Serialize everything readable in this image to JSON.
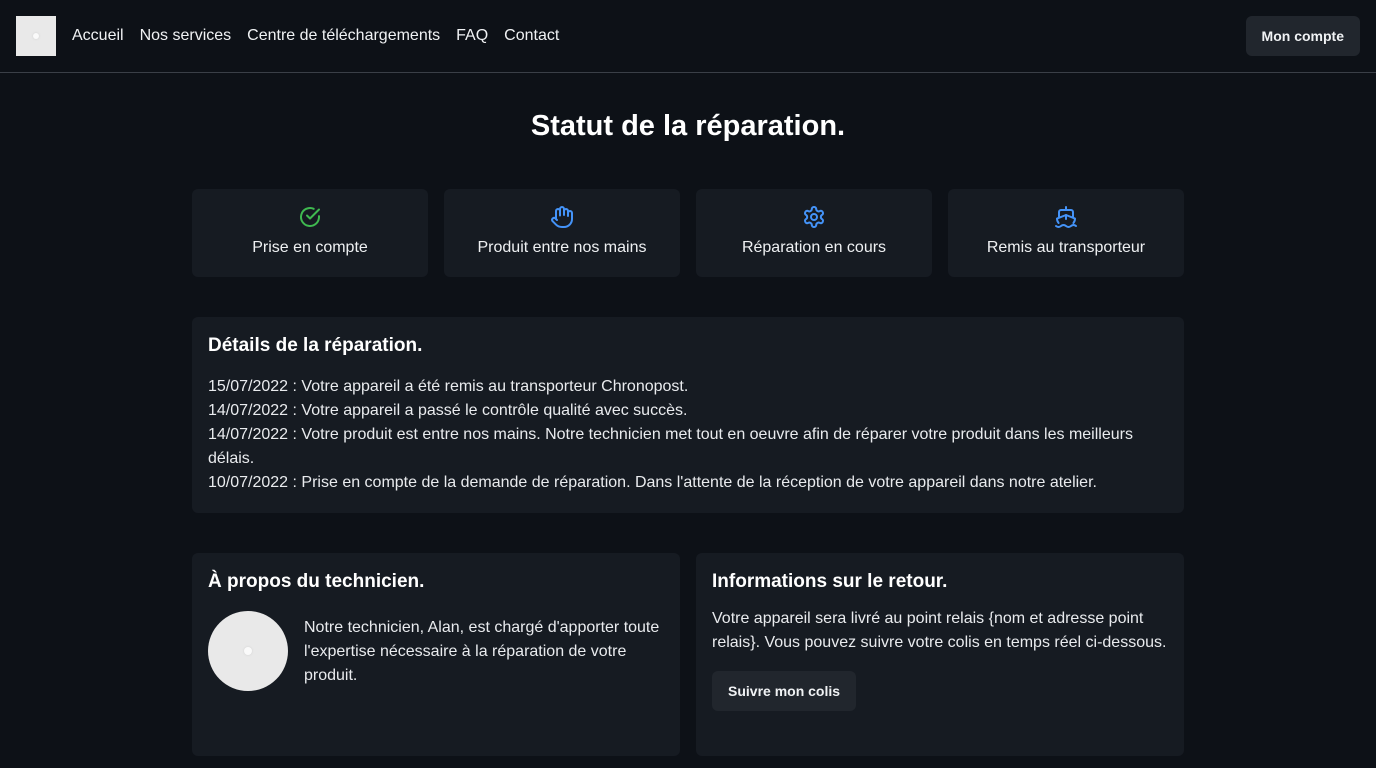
{
  "nav": {
    "links": [
      "Accueil",
      "Nos services",
      "Centre de téléchargements",
      "FAQ",
      "Contact"
    ],
    "account_button": "Mon compte"
  },
  "page_title": "Statut de la réparation.",
  "steps": [
    {
      "label": "Prise en compte",
      "icon": "check-circle-icon",
      "color": "#3fb950"
    },
    {
      "label": "Produit entre nos mains",
      "icon": "hand-icon",
      "color": "#4493f8"
    },
    {
      "label": "Réparation en cours",
      "icon": "gear-icon",
      "color": "#4493f8"
    },
    {
      "label": "Remis au transporteur",
      "icon": "ship-icon",
      "color": "#4493f8"
    }
  ],
  "details": {
    "title": "Détails de la réparation.",
    "lines": [
      "15/07/2022 : Votre appareil a été remis au transporteur Chronopost.",
      "14/07/2022 : Votre appareil a passé le contrôle qualité avec succès.",
      "14/07/2022 : Votre produit est entre nos mains. Notre technicien met tout en oeuvre afin de réparer votre produit dans les meilleurs délais.",
      "10/07/2022 : Prise en compte de la demande de réparation. Dans l'attente de la réception de votre appareil dans notre atelier."
    ]
  },
  "technician": {
    "title": "À propos du technicien.",
    "text": "Notre technicien, Alan, est chargé d'apporter toute l'expertise nécessaire à la réparation de votre produit."
  },
  "return_info": {
    "title": "Informations sur le retour.",
    "text": "Votre appareil sera livré au point relais {nom et adresse point relais}. Vous pouvez suivre votre colis en temps réel ci-dessous.",
    "button": "Suivre mon colis"
  }
}
